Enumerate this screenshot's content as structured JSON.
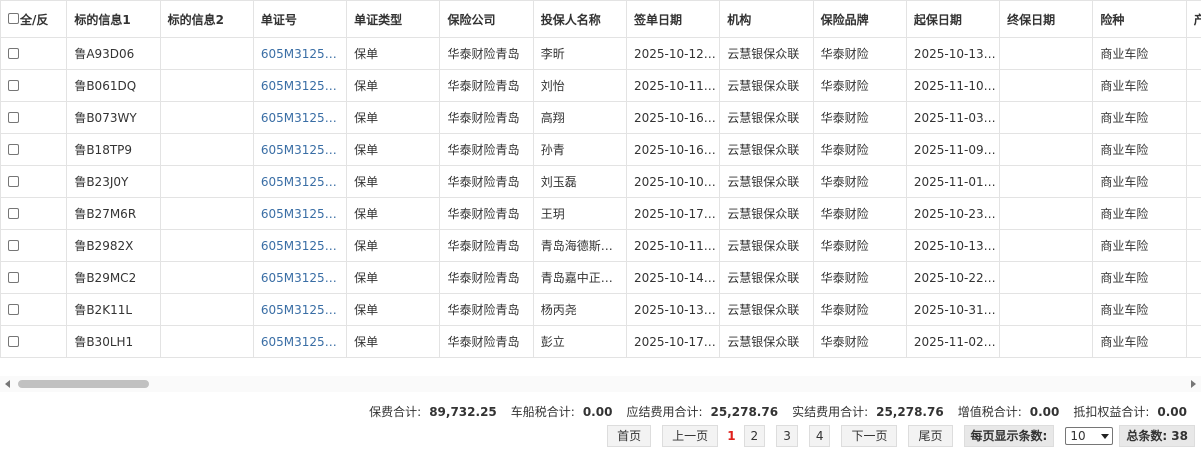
{
  "table": {
    "select_all_label": "全/反",
    "headers": [
      "标的信息1",
      "标的信息2",
      "单证号",
      "单证类型",
      "保险公司",
      "投保人名称",
      "签单日期",
      "机构",
      "保险品牌",
      "起保日期",
      "终保日期",
      "险种",
      "产品名称"
    ],
    "rows": [
      [
        "鲁A93D06",
        "",
        "605M3125…",
        "保单",
        "华泰财险青岛",
        "李昕",
        "2025-10-12…",
        "云慧银保众联",
        "华泰财险",
        "2025-10-13…",
        "",
        "商业车险",
        ""
      ],
      [
        "鲁B061DQ",
        "",
        "605M3125…",
        "保单",
        "华泰财险青岛",
        "刘怡",
        "2025-10-11…",
        "云慧银保众联",
        "华泰财险",
        "2025-11-10…",
        "",
        "商业车险",
        ""
      ],
      [
        "鲁B073WY",
        "",
        "605M3125…",
        "保单",
        "华泰财险青岛",
        "高翔",
        "2025-10-16…",
        "云慧银保众联",
        "华泰财险",
        "2025-11-03…",
        "",
        "商业车险",
        ""
      ],
      [
        "鲁B18TP9",
        "",
        "605M3125…",
        "保单",
        "华泰财险青岛",
        "孙青",
        "2025-10-16…",
        "云慧银保众联",
        "华泰财险",
        "2025-11-09…",
        "",
        "商业车险",
        ""
      ],
      [
        "鲁B23J0Y",
        "",
        "605M3125…",
        "保单",
        "华泰财险青岛",
        "刘玉磊",
        "2025-10-10…",
        "云慧银保众联",
        "华泰财险",
        "2025-11-01…",
        "",
        "商业车险",
        ""
      ],
      [
        "鲁B27M6R",
        "",
        "605M3125…",
        "保单",
        "华泰财险青岛",
        "王玥",
        "2025-10-17…",
        "云慧银保众联",
        "华泰财险",
        "2025-10-23…",
        "",
        "商业车险",
        ""
      ],
      [
        "鲁B2982X",
        "",
        "605M3125…",
        "保单",
        "华泰财险青岛",
        "青岛海德斯…",
        "2025-10-11…",
        "云慧银保众联",
        "华泰财险",
        "2025-10-13…",
        "",
        "商业车险",
        ""
      ],
      [
        "鲁B29MC2",
        "",
        "605M3125…",
        "保单",
        "华泰财险青岛",
        "青岛嘉中正…",
        "2025-10-14…",
        "云慧银保众联",
        "华泰财险",
        "2025-10-22…",
        "",
        "商业车险",
        ""
      ],
      [
        "鲁B2K11L",
        "",
        "605M3125…",
        "保单",
        "华泰财险青岛",
        "杨丙尧",
        "2025-10-13…",
        "云慧银保众联",
        "华泰财险",
        "2025-10-31…",
        "",
        "商业车险",
        ""
      ],
      [
        "鲁B30LH1",
        "",
        "605M3125…",
        "保单",
        "华泰财险青岛",
        "彭立",
        "2025-10-17…",
        "云慧银保众联",
        "华泰财险",
        "2025-11-02…",
        "",
        "商业车险",
        ""
      ]
    ]
  },
  "totals": [
    {
      "label": "保费合计:",
      "value": "89,732.25"
    },
    {
      "label": "车船税合计:",
      "value": "0.00"
    },
    {
      "label": "应结费用合计:",
      "value": "25,278.76"
    },
    {
      "label": "实结费用合计:",
      "value": "25,278.76"
    },
    {
      "label": "增值税合计:",
      "value": "0.00"
    },
    {
      "label": "抵扣权益合计:",
      "value": "0.00"
    }
  ],
  "pager": {
    "first": "首页",
    "prev": "上一页",
    "current": "1",
    "pages": [
      "2",
      "3",
      "4"
    ],
    "next": "下一页",
    "last": "尾页",
    "page_size_label": "每页显示条数:",
    "page_size": "10",
    "total_label": "总条数: 38"
  },
  "colors": {
    "link": "#3a6ea5",
    "current_page": "#e0201b"
  }
}
